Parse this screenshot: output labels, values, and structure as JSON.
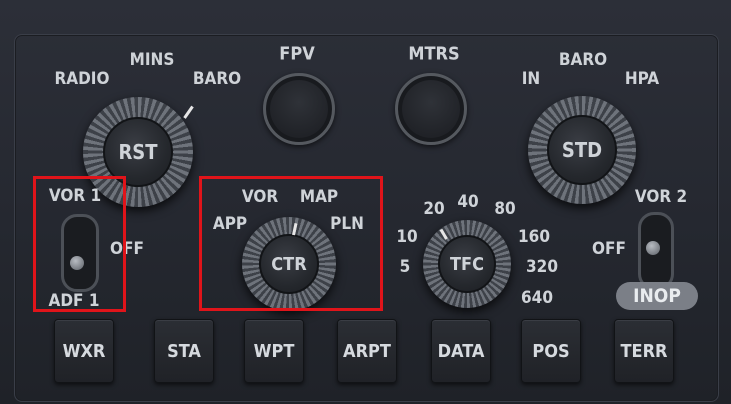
{
  "mins_selector": {
    "labels": {
      "radio": "RADIO",
      "mins": "MINS",
      "baro": "BARO"
    },
    "knob_label": "RST"
  },
  "fpv_button": {
    "label": "FPV"
  },
  "mtrs_button": {
    "label": "MTRS"
  },
  "baro_selector": {
    "labels": {
      "in": "IN",
      "baro": "BARO",
      "hpa": "HPA"
    },
    "knob_label": "STD"
  },
  "vor1_switch": {
    "top": "VOR 1",
    "side": "OFF",
    "bottom": "ADF 1"
  },
  "mode_selector": {
    "labels": {
      "app": "APP",
      "vor": "VOR",
      "map": "MAP",
      "pln": "PLN"
    },
    "knob_label": "CTR"
  },
  "range_selector": {
    "labels": [
      "5",
      "10",
      "20",
      "40",
      "80",
      "160",
      "320",
      "640"
    ],
    "knob_label": "TFC"
  },
  "vor2_switch": {
    "top": "VOR 2",
    "side": "OFF",
    "status": "INOP"
  },
  "bottom_buttons": [
    {
      "label": "WXR"
    },
    {
      "label": "STA"
    },
    {
      "label": "WPT"
    },
    {
      "label": "ARPT"
    },
    {
      "label": "DATA"
    },
    {
      "label": "POS"
    },
    {
      "label": "TERR"
    }
  ],
  "highlight_color": "#e0141a"
}
